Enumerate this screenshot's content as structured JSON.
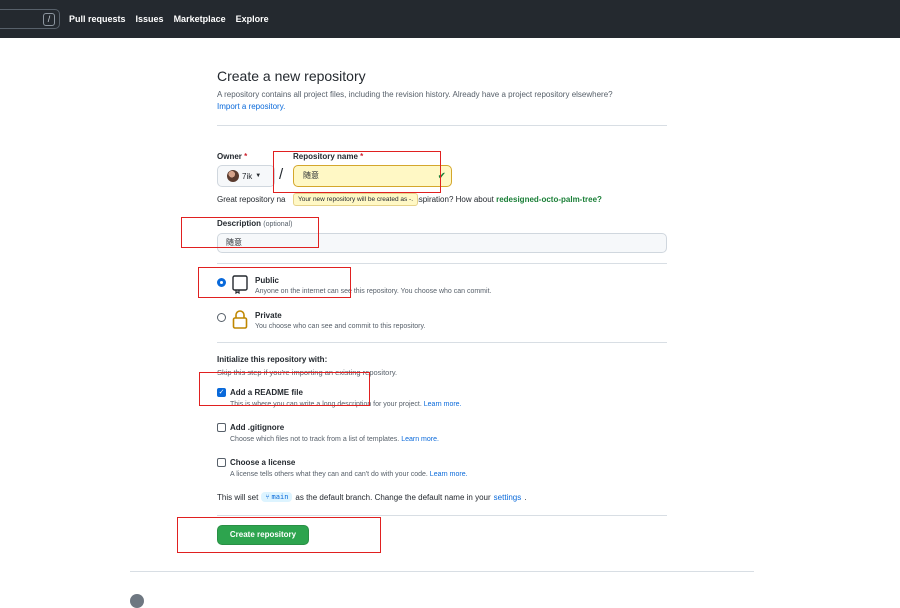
{
  "topnav": {
    "items": [
      "Pull requests",
      "Issues",
      "Marketplace",
      "Explore"
    ],
    "search_key": "/"
  },
  "header": {
    "title": "Create a new repository",
    "subtitle": "A repository contains all project files, including the revision history. Already have a project repository elsewhere?",
    "import_link": "Import a repository."
  },
  "owner": {
    "label": "Owner",
    "required": "*",
    "value": "7ik"
  },
  "separator": "/",
  "repo_name": {
    "label": "Repository name",
    "required": "*",
    "value": "随意",
    "tooltip": "Your new repository will be created as -."
  },
  "naming_hint": {
    "prefix": "Great repository na",
    "suffix": "inspiration? How about",
    "suggestion": "redesigned-octo-palm-tree?"
  },
  "description": {
    "label": "Description",
    "optional": "(optional)",
    "value": "随意"
  },
  "visibility": [
    {
      "title": "Public",
      "desc": "Anyone on the internet can see this repository. You choose who can commit.",
      "selected": true
    },
    {
      "title": "Private",
      "desc": "You choose who can see and commit to this repository.",
      "selected": false
    }
  ],
  "init": {
    "title": "Initialize this repository with:",
    "subtitle": "Skip this step if you're importing an existing repository.",
    "options": [
      {
        "title": "Add a README file",
        "desc": "This is where you can write a long description for your project.",
        "link": "Learn more.",
        "checked": true
      },
      {
        "title": "Add .gitignore",
        "desc": "Choose which files not to track from a list of templates.",
        "link": "Learn more.",
        "checked": false
      },
      {
        "title": "Choose a license",
        "desc": "A license tells others what they can and can't do with your code.",
        "link": "Learn more.",
        "checked": false
      }
    ]
  },
  "branch": {
    "prefix": "This will set",
    "name": "main",
    "suffix": "as the default branch. Change the default name in your",
    "link": "settings",
    "end": "."
  },
  "create_button": "Create repository",
  "colors": {
    "accent": "#0969da",
    "primary_button": "#2da44e",
    "annotation": "#e02020",
    "topbar": "#24292f"
  }
}
